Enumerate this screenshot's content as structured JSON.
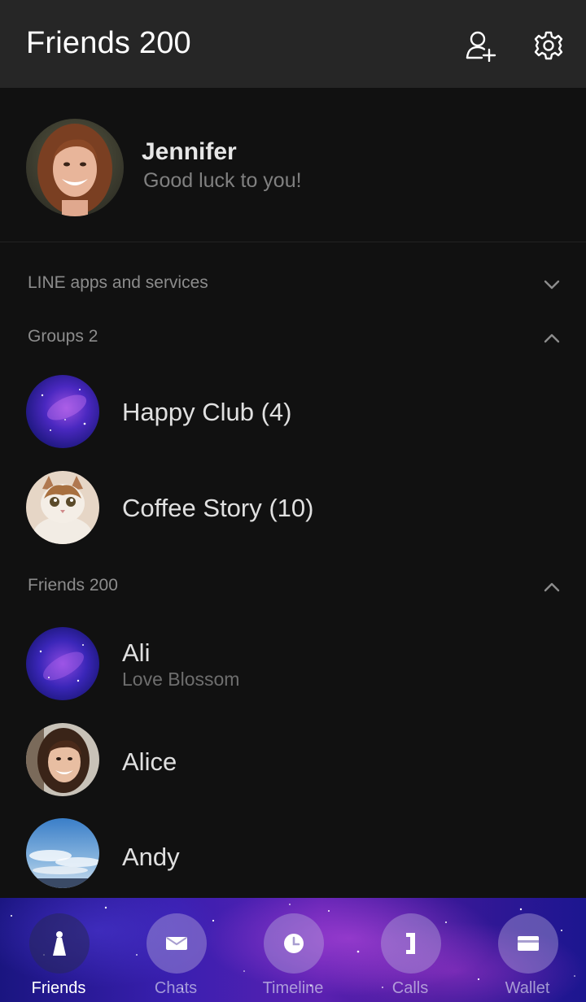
{
  "header": {
    "title": "Friends 200"
  },
  "profile": {
    "name": "Jennifer",
    "status": "Good luck to you!"
  },
  "sections": {
    "services": "LINE apps and services",
    "groups": "Groups 2",
    "friends": "Friends 200"
  },
  "groups": [
    {
      "name": "Happy Club (4)",
      "avatar": "galaxy"
    },
    {
      "name": "Coffee Story (10)",
      "avatar": "cat"
    }
  ],
  "friends": [
    {
      "name": "Ali",
      "status": "Love Blossom",
      "avatar": "galaxy"
    },
    {
      "name": "Alice",
      "status": "",
      "avatar": "person"
    },
    {
      "name": "Andy",
      "status": "",
      "avatar": "sky"
    }
  ],
  "tabs": [
    {
      "label": "Friends",
      "icon": "person-icon",
      "active": true
    },
    {
      "label": "Chats",
      "icon": "envelope-icon",
      "active": false
    },
    {
      "label": "Timeline",
      "icon": "clock-icon",
      "active": false
    },
    {
      "label": "Calls",
      "icon": "phone-icon",
      "active": false
    },
    {
      "label": "Wallet",
      "icon": "wallet-icon",
      "active": false
    }
  ],
  "colors": {
    "header_bg": "#262626",
    "body_bg": "#111111",
    "tab_gradient_start": "#1a1580",
    "tab_gradient_mid": "#5a20b0"
  }
}
